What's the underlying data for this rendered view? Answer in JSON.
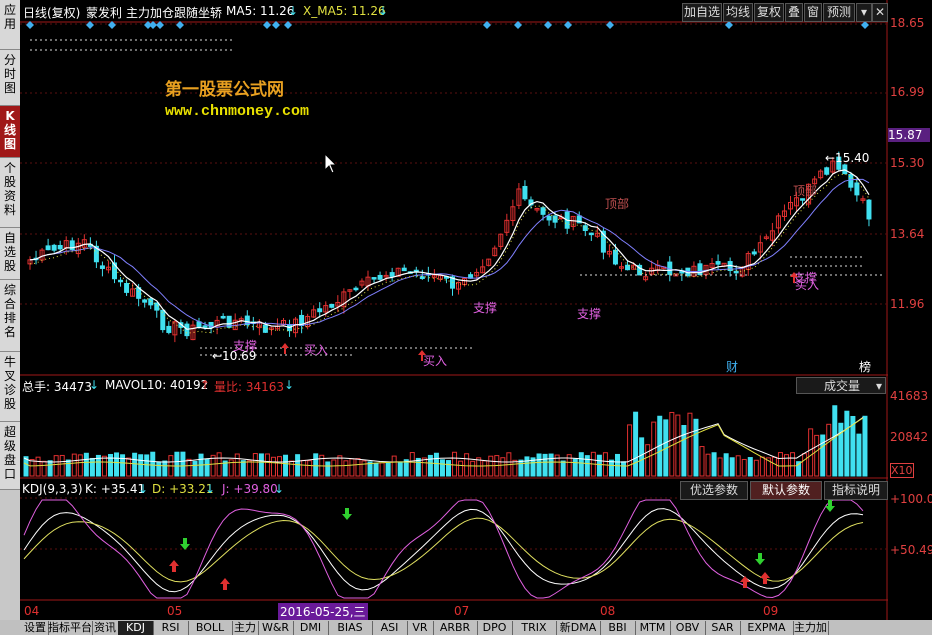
{
  "sidebar": {
    "tabs": [
      {
        "label": "应用",
        "active": false
      },
      {
        "label": "分时图",
        "active": false
      },
      {
        "label": "K线图",
        "active": true
      },
      {
        "label": "个股资料",
        "active": false
      },
      {
        "label": "自选股",
        "active": false
      },
      {
        "label": "综合排名",
        "active": false
      },
      {
        "label": "牛叉诊股",
        "active": false
      },
      {
        "label": "超级盘口",
        "active": false
      }
    ]
  },
  "header": {
    "period": "日线(复权)",
    "stock_name": "蒙发利",
    "indicator_name": "主力加仓跟随坐轿",
    "ma5": "MA5: 11.26",
    "x_ma5": "X_MA5: 11.26",
    "buttons": [
      "加自选",
      "均线",
      "复权",
      "叠",
      "窗",
      "预测"
    ],
    "menu_icon": "menu-icon",
    "close_icon": "close-icon"
  },
  "watermark": {
    "line1": "第一股票公式网",
    "line2": "www.chnmoney.com"
  },
  "price_axis": {
    "labels": [
      "18.65",
      "16.99",
      "15.87",
      "15.30",
      "13.64",
      "11.96"
    ],
    "current_price": "15.87"
  },
  "price_annotations": {
    "high_label": "15.40",
    "low_label": "10.69",
    "support_1": "支撑",
    "support_2": "支撑",
    "support_3": "支撑",
    "support_4": "支撑",
    "buy_1": "买入",
    "buy_2": "买入",
    "buy_3": "买入",
    "top_1": "顶部",
    "top_2": "顶部",
    "fin_marker": "财",
    "rank_marker": "榜"
  },
  "volume_panel": {
    "total": "总手: 34473",
    "mavol": "MAVOL10: 40192",
    "ratio": "量比: 34163",
    "dropdown": "成交量",
    "axis": [
      "41683",
      "20842",
      "X10"
    ]
  },
  "kdj_panel": {
    "name": "KDJ(9,3,3)",
    "k": "K: +35.41",
    "d": "D: +33.21",
    "j": "J: +39.80",
    "buttons": [
      "优选参数",
      "默认参数",
      "指标说明"
    ],
    "axis": [
      "+100.0",
      "+50.49"
    ]
  },
  "date_axis": {
    "labels": [
      "04",
      "05",
      "07",
      "08",
      "09"
    ],
    "highlight_date": "2016-05-25,三"
  },
  "tabbar": {
    "tabs": [
      "设置",
      "指标平台",
      "资讯",
      "KDJ",
      "RSI",
      "BOLL",
      "主力",
      "W&R",
      "DMI",
      "BIAS",
      "ASI",
      "VR",
      "ARBR",
      "DPO",
      "TRIX",
      "新DMA",
      "BBI",
      "MTM",
      "OBV",
      "SAR",
      "EXPMA",
      "主力加"
    ],
    "active": "KDJ"
  },
  "colors": {
    "up": "#e03030",
    "down": "#40e0f0",
    "ma": "#ffffff",
    "axis": "#e04040",
    "k_line": "#ffffff",
    "d_line": "#e0e060",
    "j_line": "#e060e0"
  }
}
